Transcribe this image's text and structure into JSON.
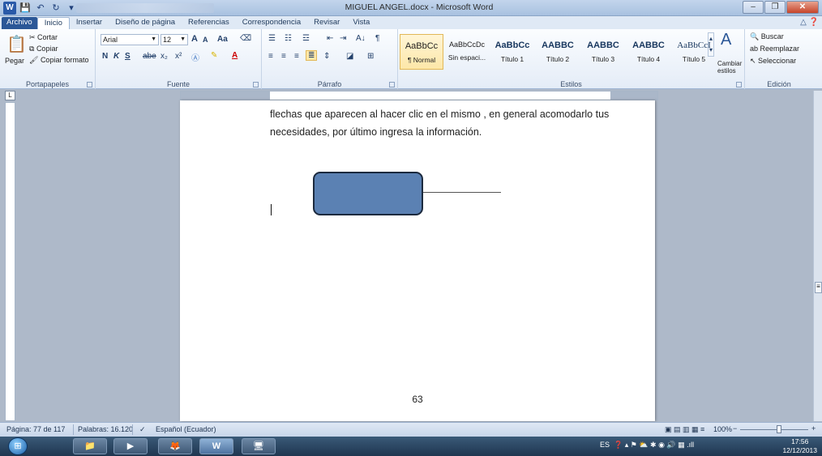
{
  "window": {
    "title": "MIGUEL ANGEL.docx - Microsoft Word",
    "app_icon": "W",
    "controls": {
      "minimize": "–",
      "maximize": "❐",
      "close": "✕"
    }
  },
  "quick_access": {
    "save": "💾",
    "undo": "↶",
    "redo": "↻",
    "customize": "▾"
  },
  "tabs": [
    "Archivo",
    "Inicio",
    "Insertar",
    "Diseño de página",
    "Referencias",
    "Correspondencia",
    "Revisar",
    "Vista"
  ],
  "tabs_active_index": 1,
  "ribbon": {
    "clipboard": {
      "paste": "Pegar",
      "cut": "Cortar",
      "copy": "Copiar",
      "format_painter": "Copiar formato",
      "label": "Portapapeles"
    },
    "font": {
      "name": "Arial",
      "size": "12",
      "grow": "A",
      "shrink": "A",
      "case": "Aa",
      "bold": "N",
      "italic": "K",
      "underline": "S",
      "strike": "abe",
      "subscript": "x₂",
      "superscript": "x²",
      "label": "Fuente"
    },
    "paragraph": {
      "label": "Párrafo",
      "pilcrow": "¶",
      "sort": "A↓"
    },
    "styles": {
      "items": [
        {
          "sample": "AaBbCc",
          "name": "¶ Normal"
        },
        {
          "sample": "AaBbCcDc",
          "name": "Sin espaci..."
        },
        {
          "sample": "AaBbCc",
          "name": "Título 1"
        },
        {
          "sample": "AABBC",
          "name": "Título 2"
        },
        {
          "sample": "AABBC",
          "name": "Título 3"
        },
        {
          "sample": "AABBC",
          "name": "Título 4"
        },
        {
          "sample": "AaBbCcI",
          "name": "Título 5"
        }
      ],
      "change_styles": "Cambiar estilos",
      "label": "Estilos"
    },
    "editing": {
      "find": "Buscar",
      "replace": "Reemplazar",
      "select": "Seleccionar",
      "label": "Edición"
    }
  },
  "document": {
    "lines": [
      "flechas que aparecen al hacer clic en el mismo , en general acomodarlo tus",
      "necesidades, por último ingresa la información."
    ],
    "page_number": "63",
    "shape_color": "#5b81b3"
  },
  "statusbar": {
    "page": "Página: 77 de 117",
    "words": "Palabras: 16.120",
    "language": "Español (Ecuador)",
    "zoom": "100%",
    "zoom_minus": "−",
    "zoom_plus": "+"
  },
  "taskbar": {
    "start": "⊞",
    "apps": [
      "📁",
      "▶",
      "🦊",
      "W",
      "🖥"
    ],
    "language": "ES",
    "time": "17:56",
    "date": "12/12/2013"
  }
}
